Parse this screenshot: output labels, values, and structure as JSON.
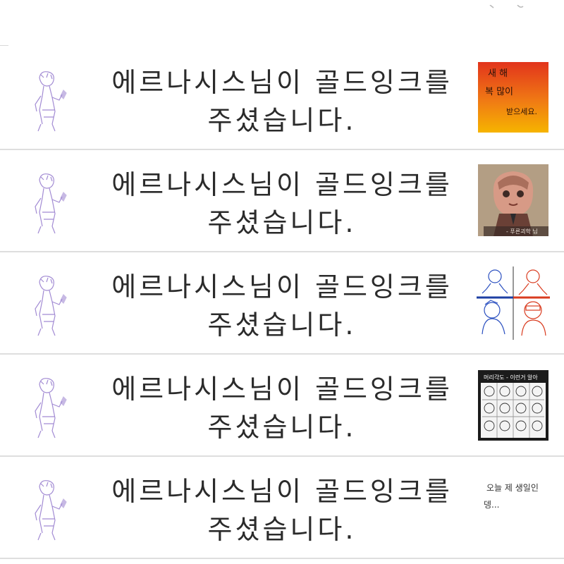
{
  "notifications": [
    {
      "message_line1": "에르나시스님이 골드잉크를",
      "message_line2": "주셨습니다.",
      "avatar_icon": "sketch-figure-avatar",
      "thumbnail": {
        "icon": "orange-gradient-handwriting-thumbnail",
        "text_lines": [
          "새 해",
          "복 많이",
          "받으세요."
        ]
      }
    },
    {
      "message_line1": "에르나시스님이 골드잉크를",
      "message_line2": "주셨습니다.",
      "avatar_icon": "sketch-figure-avatar",
      "thumbnail": {
        "icon": "character-portrait-thumbnail",
        "caption": "- 푸른괴학 님"
      }
    },
    {
      "message_line1": "에르나시스님이 골드잉크를",
      "message_line2": "주셨습니다.",
      "avatar_icon": "sketch-figure-avatar",
      "thumbnail": {
        "icon": "blue-red-head-sketch-thumbnail"
      }
    },
    {
      "message_line1": "에르나시스님이 골드잉크를",
      "message_line2": "주셨습니다.",
      "avatar_icon": "sketch-figure-avatar",
      "thumbnail": {
        "icon": "head-angle-reference-grid-thumbnail",
        "header_text": "머리각도 - 이런거 알아"
      }
    },
    {
      "message_line1": "에르나시스님이 골드잉크를",
      "message_line2": "주셨습니다.",
      "avatar_icon": "sketch-figure-avatar",
      "thumbnail": {
        "icon": "handwritten-note-thumbnail",
        "text_lines": [
          "오늘 제 생일인",
          "뎅..."
        ]
      }
    }
  ]
}
